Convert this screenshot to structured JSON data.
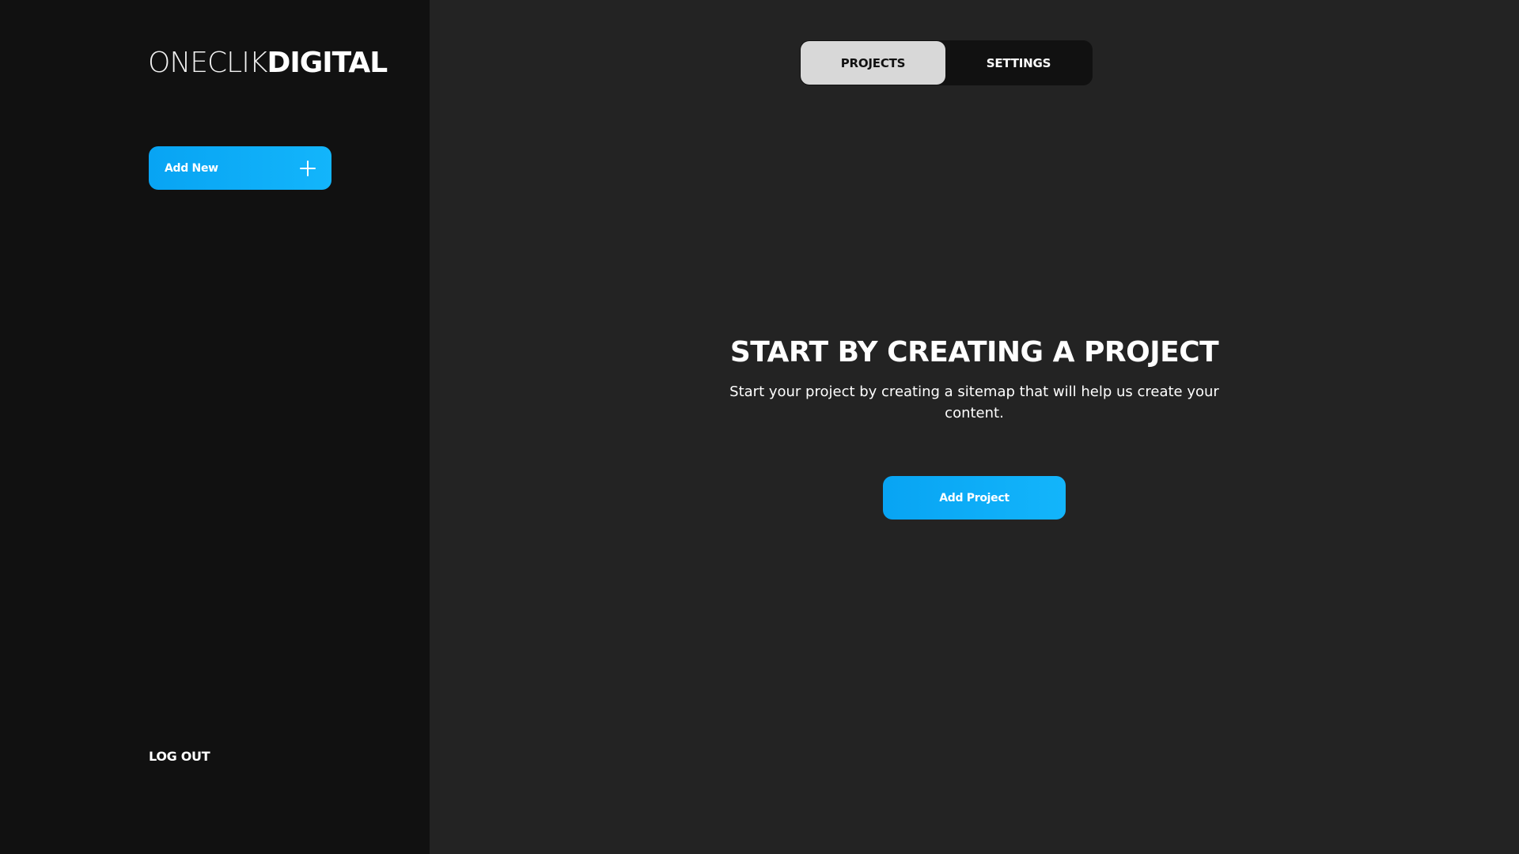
{
  "brand": {
    "logo_light": "ONECLIK",
    "logo_bold": "DIGITAL"
  },
  "sidebar": {
    "add_new_label": "Add New",
    "add_new_icon": "plus-icon",
    "logout_label": "LOG OUT"
  },
  "tabs": [
    {
      "label": "PROJECTS",
      "active": true
    },
    {
      "label": "SETTINGS",
      "active": false
    }
  ],
  "empty_state": {
    "title": "START BY CREATING A PROJECT",
    "description": "Start your project by creating a sitemap that will help us create your content.",
    "button_label": "Add Project"
  },
  "colors": {
    "accent": "#0aa8f5",
    "sidebar_bg": "#111111",
    "main_bg": "#232323",
    "tab_active_bg": "#d8d8d8"
  }
}
